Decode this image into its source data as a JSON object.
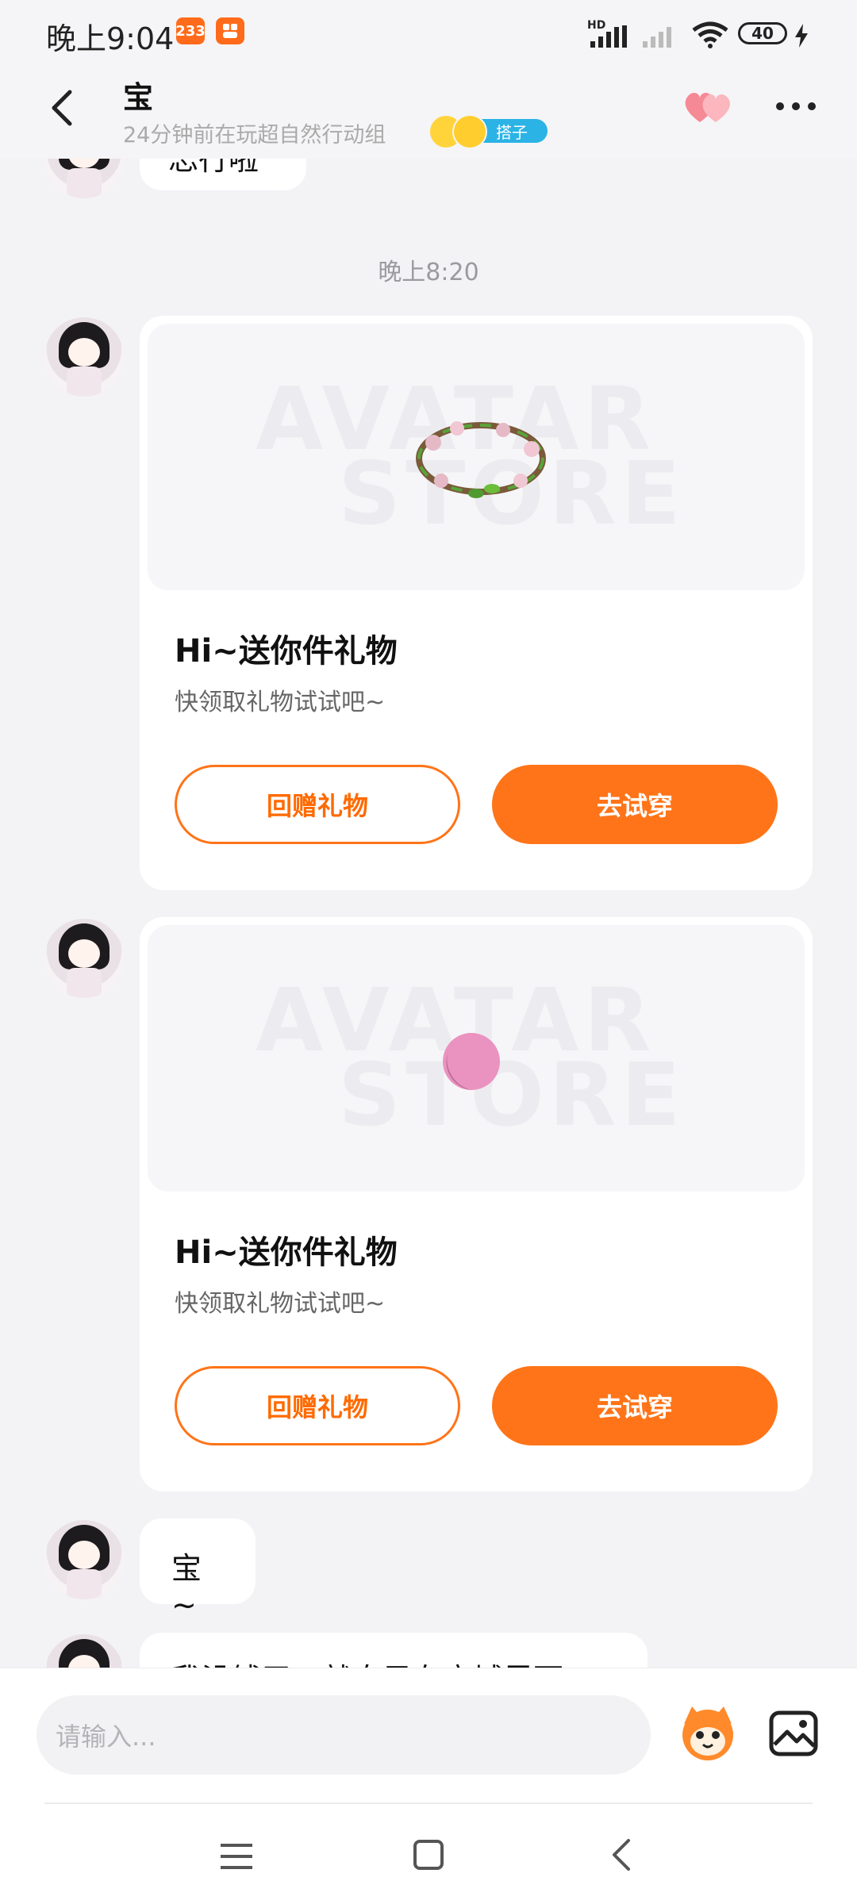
{
  "status_bar": {
    "time": "晚上9:04",
    "badge_1": "233",
    "battery": "40",
    "signal_label": "HD"
  },
  "header": {
    "title": "宝",
    "subtitle": "24分钟前在玩超自然行动组",
    "tag": "搭子"
  },
  "messages": {
    "top_partial": "忘行啦",
    "timestamp": "晚上8:20",
    "cards": [
      {
        "watermark_line1": "AVATAR",
        "watermark_line2": "STORE",
        "title": "Hi~送你件礼物",
        "subtitle": "快领取礼物试试吧~",
        "left_button": "回赠礼物",
        "right_button": "去试穿"
      },
      {
        "watermark_line1": "AVATAR",
        "watermark_line2": "STORE",
        "title": "Hi~送你件礼物",
        "subtitle": "快领取礼物试试吧~",
        "left_button": "回赠礼物",
        "right_button": "去试穿"
      }
    ],
    "text_bubble": "宝~",
    "bottom_partial": "我没钱了，就自己在商城里面"
  },
  "input": {
    "placeholder": "请输入..."
  },
  "colors": {
    "accent": "#ff7418",
    "background": "#f3f3f6",
    "tag": "#2bb3e6"
  },
  "icons": {
    "back": "back-arrow-icon",
    "hearts": "hearts-icon",
    "more": "more-icon",
    "mascot": "mascot-icon",
    "image": "image-icon"
  }
}
